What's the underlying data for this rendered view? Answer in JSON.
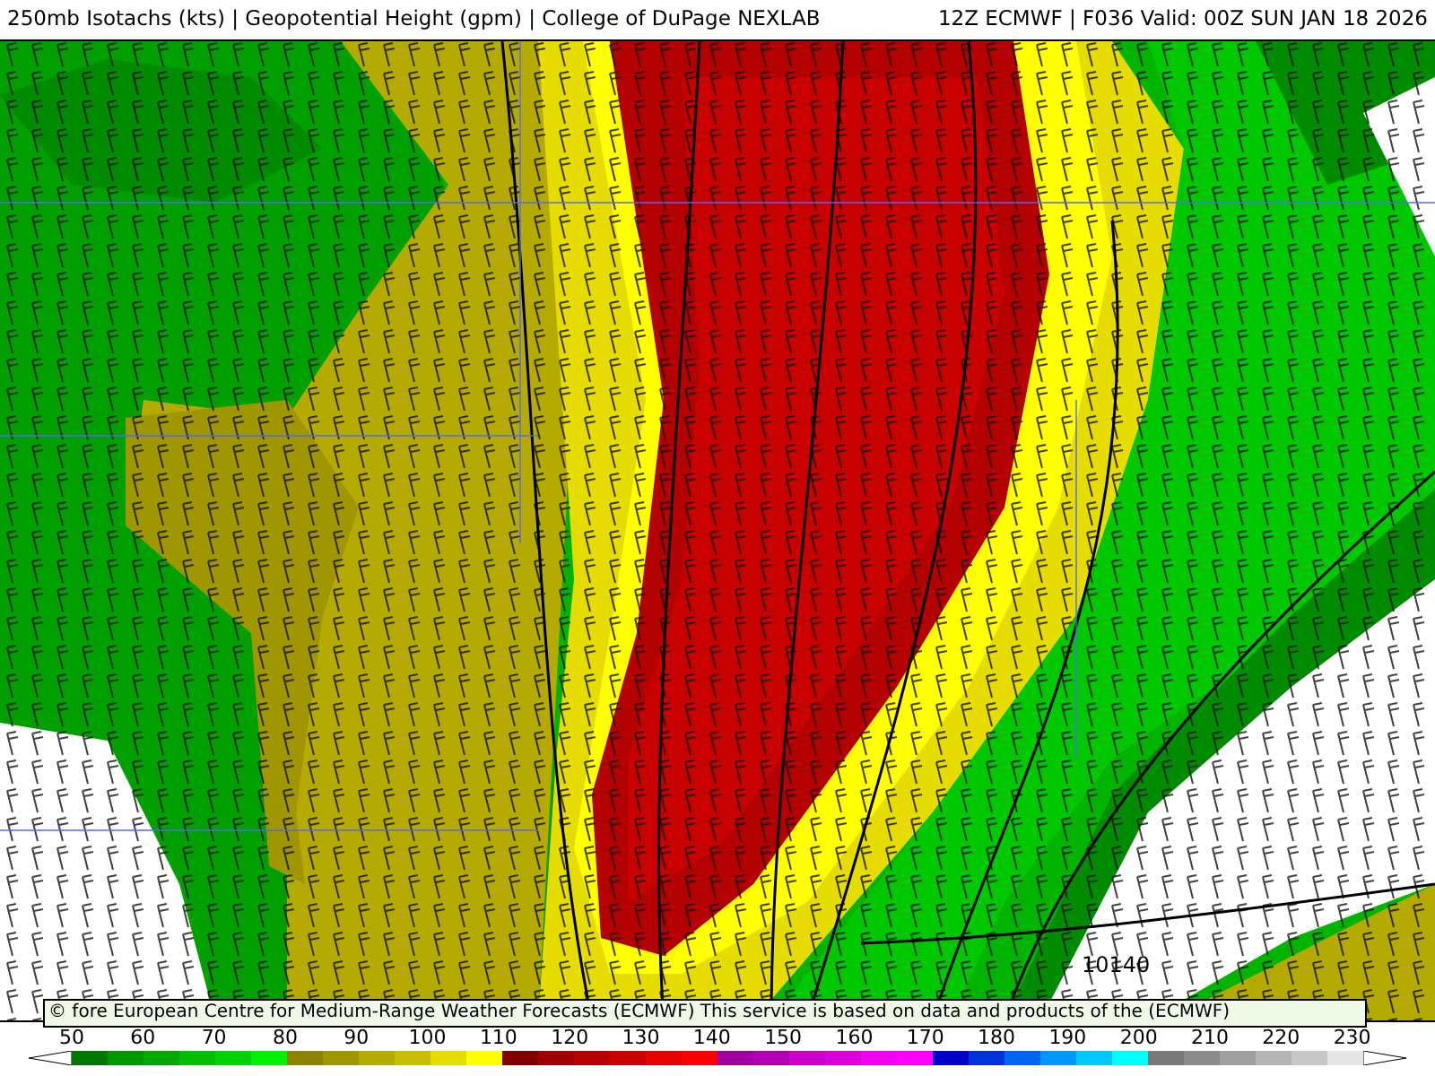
{
  "header": {
    "title": "250mb Isotachs (kts) | Geopotential Height (gpm) | College of DuPage NEXLAB",
    "run": "12Z ECMWF | F036 Valid: 00Z SUN JAN 18 2026"
  },
  "map": {
    "contour_label": "10140"
  },
  "credit": "© fore European Centre for Medium-Range Weather Forecasts (ECMWF)  This service is based on data and products of the (ECMWF)",
  "legend": {
    "labels": [
      "50",
      "60",
      "70",
      "80",
      "90",
      "100",
      "110",
      "120",
      "130",
      "140",
      "150",
      "160",
      "170",
      "180",
      "190",
      "200",
      "210",
      "220",
      "230"
    ],
    "segments": [
      {
        "color": "#007800"
      },
      {
        "color": "#009600"
      },
      {
        "color": "#00a800"
      },
      {
        "color": "#00be00"
      },
      {
        "color": "#00d200"
      },
      {
        "color": "#00f000"
      },
      {
        "color": "#8c8200"
      },
      {
        "color": "#a09600"
      },
      {
        "color": "#b4aa00"
      },
      {
        "color": "#c8be00"
      },
      {
        "color": "#e6dc00"
      },
      {
        "color": "#ffff00"
      },
      {
        "color": "#820000"
      },
      {
        "color": "#a00000"
      },
      {
        "color": "#b40000"
      },
      {
        "color": "#c80000"
      },
      {
        "color": "#e60000"
      },
      {
        "color": "#ff0000"
      },
      {
        "color": "#a000a0"
      },
      {
        "color": "#b400b4"
      },
      {
        "color": "#c800c8"
      },
      {
        "color": "#dc00dc"
      },
      {
        "color": "#f000f0"
      },
      {
        "color": "#ff00ff"
      },
      {
        "color": "#0000c8"
      },
      {
        "color": "#0032dc"
      },
      {
        "color": "#0064f0"
      },
      {
        "color": "#0096ff"
      },
      {
        "color": "#00c8ff"
      },
      {
        "color": "#00ffff"
      },
      {
        "color": "#787878"
      },
      {
        "color": "#8c8c8c"
      },
      {
        "color": "#a0a0a0"
      },
      {
        "color": "#b4b4b4"
      },
      {
        "color": "#c8c8c8"
      },
      {
        "color": "#e6e6e6"
      }
    ]
  }
}
